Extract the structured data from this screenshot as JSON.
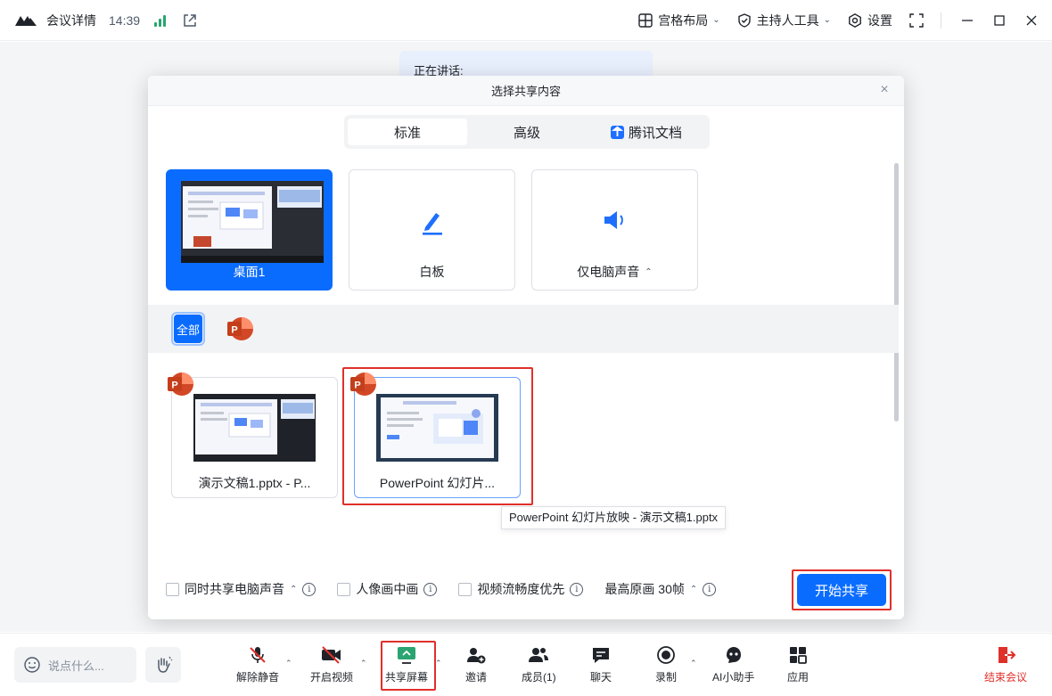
{
  "titlebar": {
    "meeting_details": "会议详情",
    "time": "14:39",
    "layout_label": "宫格布局",
    "host_tools_label": "主持人工具",
    "settings_label": "设置"
  },
  "stage": {
    "speaking_label": "正在讲话:"
  },
  "dialog": {
    "title": "选择共享内容",
    "close": "×",
    "tabs": [
      {
        "label": "标准",
        "active": true
      },
      {
        "label": "高级",
        "active": false
      },
      {
        "label": "腾讯文档",
        "active": false
      }
    ],
    "cards": [
      {
        "label": "桌面1",
        "selected": true
      },
      {
        "label": "白板",
        "selected": false
      },
      {
        "label": "仅电脑声音",
        "selected": false
      }
    ],
    "filter_all": "全部",
    "windows": [
      {
        "label": "演示文稿1.pptx - P..."
      },
      {
        "label": "PowerPoint 幻灯片..."
      }
    ],
    "tooltip": "PowerPoint 幻灯片放映  -  演示文稿1.pptx",
    "options": {
      "share_audio": "同时共享电脑声音",
      "pip": "人像画中画",
      "video_smooth": "视频流畅度优先",
      "max_quality": "最高原画 30帧"
    },
    "start_button": "开始共享"
  },
  "toolbar": {
    "chat_placeholder": "说点什么...",
    "unmute": "解除静音",
    "start_video": "开启视频",
    "share_screen": "共享屏幕",
    "invite": "邀请",
    "members": "成员(1)",
    "chat": "聊天",
    "record": "录制",
    "ai_assistant": "AI小助手",
    "apps": "应用",
    "end_meeting": "结束会议"
  },
  "colors": {
    "accent": "#0a6cff",
    "danger": "#e0302a",
    "signal": "#2ba471",
    "ppt": "#d24726"
  }
}
